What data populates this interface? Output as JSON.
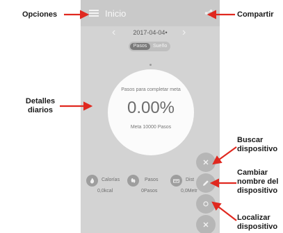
{
  "callouts": {
    "options": "Opciones",
    "share": "Compartir",
    "daily_details_line1": "Detalles",
    "daily_details_line2": "diarios",
    "search_device_line1": "Buscar",
    "search_device_line2": "dispositivo",
    "rename_device_line1": "Cambiar",
    "rename_device_line2": "nombre del",
    "rename_device_line3": "dispositivo",
    "locate_device_line1": "Localizar",
    "locate_device_line2": "dispositivo",
    "arrow_color": "#e0281f"
  },
  "app": {
    "title": "Inicio",
    "date": "2017-04-04",
    "date_suffix": "•",
    "tabs": [
      "Pasos",
      "Sueño"
    ],
    "selected_tab": "Pasos",
    "progress_label": "Pasos para completar meta",
    "progress_value": "0.00%",
    "goal": "Meta 10000 Pasos"
  },
  "stats": [
    {
      "label": "Calorías",
      "value": "0,0kcal",
      "icon": "flame-icon"
    },
    {
      "label": "Pasos",
      "value": "0Pasos",
      "icon": "footprint-icon"
    },
    {
      "label": "Dist",
      "value": "0,0Metr",
      "icon": "distance-icon"
    }
  ],
  "colors": {
    "screen_bg": "#d3d3d3",
    "topbar_bg": "#c9c9c9",
    "circle_bg": "#fbfbfb",
    "fab_bg": "#b6b6b6"
  }
}
